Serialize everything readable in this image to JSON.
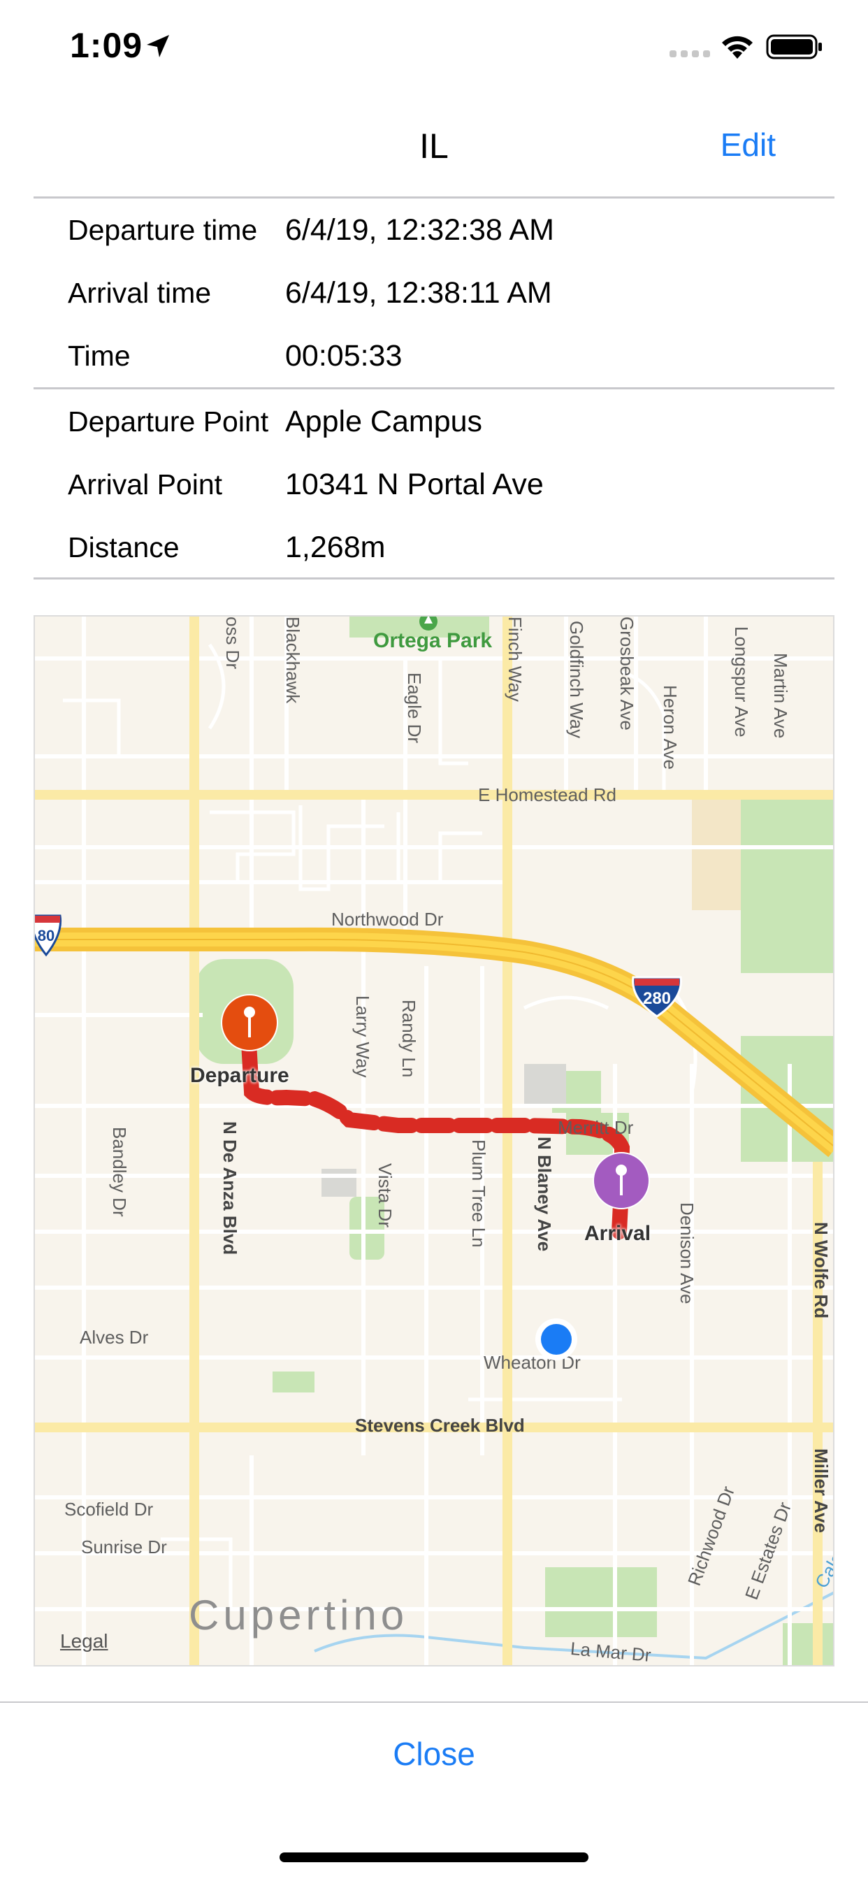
{
  "status_bar": {
    "time": "1:09"
  },
  "nav": {
    "title": "IL",
    "edit_label": "Edit"
  },
  "trip_info": [
    {
      "label": "Departure time",
      "value": "6/4/19, 12:32:38 AM"
    },
    {
      "label": "Arrival time",
      "value": "6/4/19, 12:38:11 AM"
    },
    {
      "label": "Time",
      "value": "00:05:33"
    }
  ],
  "location_info": [
    {
      "label": "Departure Point",
      "value": "Apple Campus"
    },
    {
      "label": "Arrival Point",
      "value": "10341 N Portal Ave"
    },
    {
      "label": "Distance",
      "value": "1,268m"
    }
  ],
  "map": {
    "park": "Ortega Park",
    "city": "Cupertino",
    "legal": "Legal",
    "departure_pin": "Departure",
    "arrival_pin": "Arrival",
    "highway_shield": "280",
    "highway_shield_partial": "80",
    "route_color": "#d92b23",
    "departure_color": "#e44d0f",
    "arrival_color": "#a35bc0",
    "streets": {
      "homestead": "E Homestead Rd",
      "northwood": "Northwood Dr",
      "stevens": "Stevens Creek Blvd",
      "alves": "Alves Dr",
      "scofield": "Scofield Dr",
      "sunrise": "Sunrise Dr",
      "la_mar": "La Mar Dr",
      "wheaton": "Wheaton Dr",
      "merritt": "Merritt Dr",
      "de_anza": "N De Anza Blvd",
      "blaney": "N Blaney Ave",
      "wolfe": "N Wolfe Rd",
      "miller": "Miller Ave",
      "bandley": "Bandley Dr",
      "vista": "Vista Dr",
      "plum_tree": "Plum Tree Ln",
      "denison": "Denison Ave",
      "larry": "Larry Way",
      "randy": "Randy Ln",
      "eagle": "Eagle Dr",
      "finch": "Finch Way",
      "goldfinch": "Goldfinch Way",
      "grosbeak": "Grosbeak Ave",
      "heron": "Heron Ave",
      "longspur": "Longspur Ave",
      "martin": "Martin Ave",
      "blackhawk": "Blackhawk",
      "ross": "oss Dr",
      "richwood": "Richwood Dr",
      "estates": "E Estates Dr",
      "calabazas": "Calab"
    }
  },
  "footer": {
    "close_label": "Close"
  }
}
